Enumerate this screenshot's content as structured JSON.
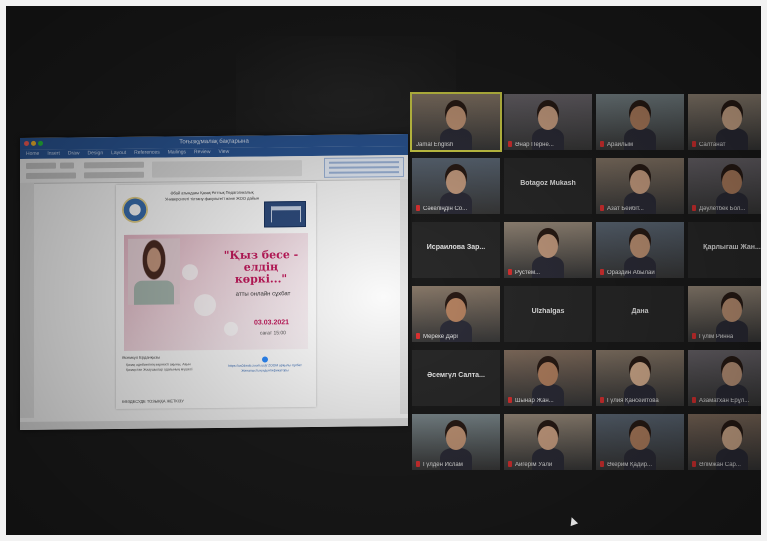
{
  "screen_share": {
    "window_title": "Тоғызқұмалақ бақтарына",
    "menu_tabs": [
      "Home",
      "Insert",
      "Draw",
      "Design",
      "Layout",
      "References",
      "Mailings",
      "Review",
      "View"
    ],
    "doc": {
      "header_text": "Әбай атындағы Қазақ Ұлттық Педагогикалық Университеті тілтану факультеті және ЖОО дайын",
      "poster_title": "\"Қыз бесе - елдің көркі...\"",
      "poster_subtitle": "атты онлайн сұхбат",
      "date": "03.03.2021",
      "time": "сағат 15:00",
      "name_line": "Әсемкүл Ерданқызы",
      "description": "Қазақ әдебиетінің көрнекті ақыны, Ақын Қазақстан Жазушылар одағының мүшесі",
      "zoom_info": "https://us04web.zoom.us/j/ ZOOM арқылы сұхбат",
      "zoom_info_2": "Жиналыстың идентификаторы",
      "bottom_line": "КӨЗДЕСУДЕ ТОЗЫҚҚА ЖЕТКІЗУ"
    }
  },
  "participants": [
    {
      "name": "Jamal English",
      "type": "video",
      "speaking": true
    },
    {
      "name": "Әнар Перне...",
      "type": "video",
      "muted": true
    },
    {
      "name": "Арайлым",
      "type": "video",
      "muted": true
    },
    {
      "name": "Салтанат",
      "type": "video",
      "muted": true
    },
    {
      "name": "Сәкеліңдін Со...",
      "type": "video",
      "muted": true
    },
    {
      "name": "Botagoz Mukash",
      "type": "name"
    },
    {
      "name": "Азат Бейбіт...",
      "type": "video",
      "muted": true
    },
    {
      "name": "Дәулетбек Бол...",
      "type": "video",
      "muted": true
    },
    {
      "name": "Исраилова Зар...",
      "type": "name"
    },
    {
      "name": "Рустем...",
      "type": "video",
      "muted": true
    },
    {
      "name": "Ораздин Абылай",
      "type": "video",
      "muted": true
    },
    {
      "name": "Қарлыгаш Жан...",
      "type": "name"
    },
    {
      "name": "Мереке Дәрі",
      "type": "video",
      "muted": true
    },
    {
      "name": "Ulzhalgas",
      "type": "name"
    },
    {
      "name": "Дана",
      "type": "name"
    },
    {
      "name": "Гүлім Ринна",
      "type": "video",
      "muted": true
    },
    {
      "name": "Әсемгүл Салта...",
      "type": "name"
    },
    {
      "name": "Шынар Жан...",
      "type": "video",
      "muted": true
    },
    {
      "name": "Гүлия Қансейітова",
      "type": "video",
      "muted": true
    },
    {
      "name": "Азаматхан Ерұл...",
      "type": "video",
      "muted": true
    },
    {
      "name": "Гүлден Ислам",
      "type": "video",
      "muted": true
    },
    {
      "name": "Айгерім Уали",
      "type": "video",
      "muted": true
    },
    {
      "name": "Әкерим Қадир...",
      "type": "video",
      "muted": true
    },
    {
      "name": "Әлімжан Сар...",
      "type": "video",
      "muted": true
    }
  ],
  "colors": {
    "active_speaker_border": "#d8d84a",
    "muted_icon": "#e33333",
    "word_title_bar": "#2b5797",
    "poster_title": "#c2185b"
  }
}
